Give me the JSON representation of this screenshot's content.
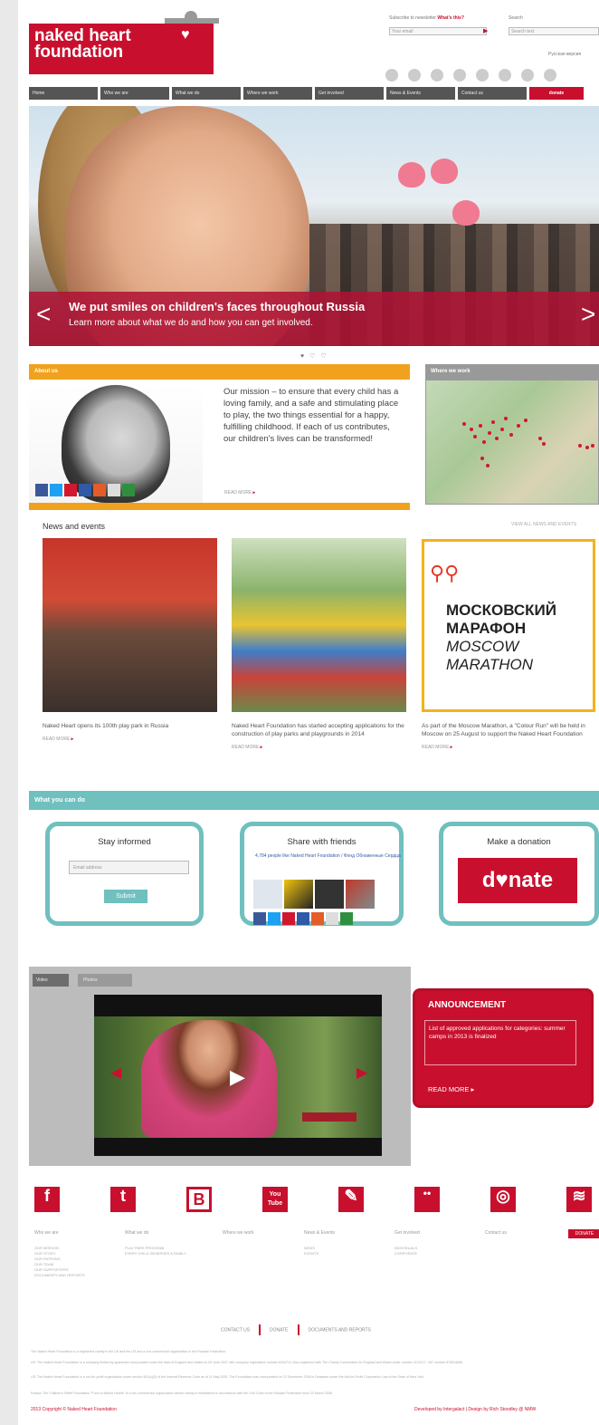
{
  "header": {
    "logo_line1": "naked heart",
    "logo_line2": "foundation",
    "newsletter_label": "Subscribe to newsletter",
    "newsletter_link": "What's this?",
    "newsletter_placeholder": "Your email",
    "search_label": "Search",
    "search_placeholder": "Search text",
    "language_link": "Русская версия"
  },
  "nav": {
    "items": [
      "Home",
      "Who we are",
      "What we do",
      "Where we work",
      "Get involved",
      "News & Events",
      "Contact us"
    ],
    "donate": "donate"
  },
  "hero": {
    "headline": "We put smiles on children's faces throughout Russia",
    "subline": "Learn more about what we do and how you can get involved.",
    "prev": "<",
    "next": ">",
    "dots": "♥ ♡ ♡"
  },
  "about": {
    "heading": "About us",
    "text": "Our mission – to ensure that every child has a loving family, and a safe and stimulating place to play, the two things essential for a happy, fulfilling childhood. If each of us contributes, our children's lives can be transformed!",
    "read_more": "READ MORE"
  },
  "where": {
    "heading": "Where we work"
  },
  "news": {
    "heading": "News and events",
    "all_link": "VIEW ALL NEWS AND EVENTS",
    "items": [
      {
        "text": "Naked Heart opens its 100th play park in Russia",
        "more": "READ MORE"
      },
      {
        "text": "Naked Heart Foundation has started accepting applications for the construction of play parks and playgrounds in 2014",
        "more": "READ MORE"
      },
      {
        "text": "As part of the Moscow Marathon, a \"Colour Run\" will be held in Moscow on 25 August to support the Naked Heart Foundation",
        "more": "READ MORE"
      }
    ],
    "marathon": {
      "line1": "МОСКОВСКИЙ",
      "line2": "МАРАФОН",
      "line3": "MOSCOW",
      "line4": "MARATHON"
    }
  },
  "actions": {
    "heading": "What you can do",
    "stay": {
      "title": "Stay informed",
      "placeholder": "Email address",
      "button": "Submit"
    },
    "share": {
      "title": "Share with friends",
      "fb_text": "4,784 people like Naked Heart Foundation / Фонд Обнаженные Сердца"
    },
    "donate": {
      "title": "Make a donation",
      "button": "d♥nate"
    }
  },
  "media": {
    "tab1": "Video",
    "tab2": "Photos",
    "announcement_title": "ANNOUNCEMENT",
    "announcement_text": "List of approved applications for categories: summer camps in 2013 is finalized",
    "announcement_more": "READ MORE ▸"
  },
  "footer": {
    "icons": [
      "f",
      "t",
      "B",
      "You Tube",
      "✎",
      "••",
      "◎",
      "≋"
    ],
    "columns": [
      {
        "title": "Who we are",
        "items": [
          "OUR MISSION",
          "OUR STORY",
          "OUR PATRONS",
          "OUR TEAM",
          "OUR SUPPORTERS",
          "DOCUMENTS AND REPORTS"
        ]
      },
      {
        "title": "What we do",
        "items": [
          "PLAY PARK PROGRAM",
          "EVERY CHILD DESERVES A FAMILY"
        ]
      },
      {
        "title": "Where we work",
        "items": []
      },
      {
        "title": "News & Events",
        "items": [
          "NEWS",
          "EVENTS"
        ]
      },
      {
        "title": "Get involved",
        "items": [
          "INDIVIDUALS",
          "CORPORATE"
        ]
      },
      {
        "title": "Contact us",
        "items": []
      }
    ],
    "donate": "DONATE",
    "links": [
      "CONTACT US",
      "DONATE",
      "DOCUMENTS AND REPORTS"
    ],
    "legal": [
      "The Naked Heart Foundation is a registered charity in the UK and the US and a non-commercial organisation in the Russian Federation.",
      "UK: The Naked Heart Foundation is a company limited by guarantee incorporated under the laws of England and Wales on 04 June 2007 with company registration number 6254714. Also registered with The Charity Commission for England and Wales under number 1123127, VAT number 870514696.",
      "US: The Naked Heart Foundation is a not-for-profit organization under section 501(c)(3) of the Internal Revenue Code as of 11 May 2009. The Foundation was incorporated on 12 December 2008 in Delaware under the Not-for-Profit Corporation Law of the State of New York.",
      "Russia: The Children's Relief Foundation \"Fund of Naked Hearts\" is a non-commercial organization whose charity is established in accordance with the Civil Code of the Russian Federation from 23 March 2006."
    ],
    "copyright": "2013 Copyright © Naked Heart Foundation",
    "credit": "Developed by Intergalact | Design by Rich Stoodley @ NMW"
  }
}
